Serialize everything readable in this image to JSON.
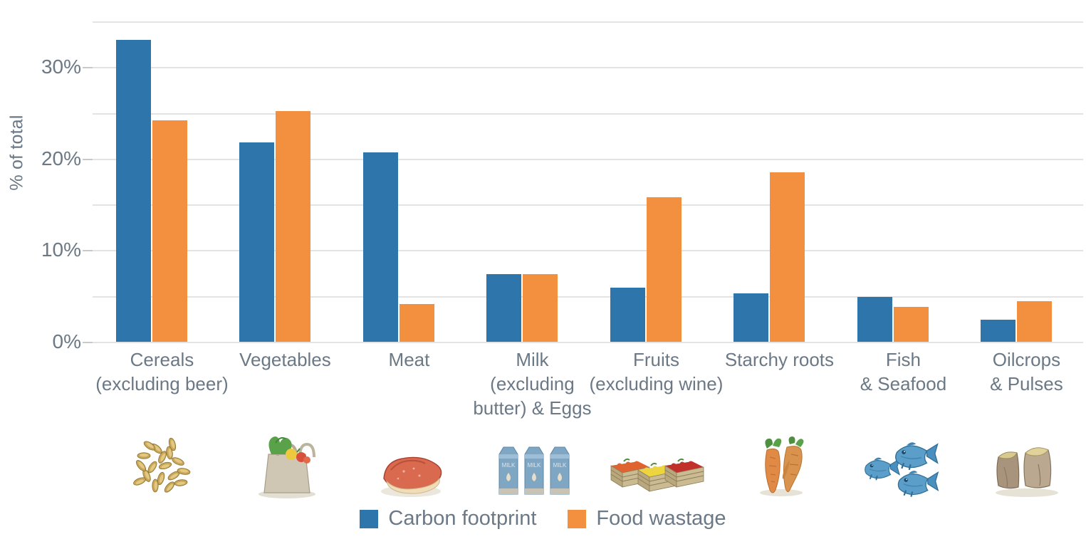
{
  "chart_data": {
    "type": "bar",
    "title": "",
    "xlabel": "",
    "ylabel": "% of total",
    "ylim": [
      0,
      35
    ],
    "ytick_step": 5,
    "ytick_labels": [
      "0%",
      "10%",
      "20%",
      "30%"
    ],
    "ytick_label_values": [
      0,
      10,
      20,
      30
    ],
    "grid": true,
    "legend_position": "bottom-center",
    "categories": [
      "Cereals\n(excluding beer)",
      "Vegetables",
      "Meat",
      "Milk\n(excluding\nbutter) & Eggs",
      "Fruits\n(excluding wine)",
      "Starchy roots",
      "Fish\n& Seafood",
      "Oilcrops\n& Pulses"
    ],
    "series": [
      {
        "name": "Carbon footprint",
        "color": "#2e75ab",
        "values": [
          33.0,
          21.8,
          20.7,
          7.4,
          5.9,
          5.3,
          4.9,
          2.4
        ]
      },
      {
        "name": "Food wastage",
        "color": "#f3903f",
        "values": [
          24.2,
          25.2,
          4.1,
          7.4,
          15.8,
          18.5,
          3.8,
          4.4
        ]
      }
    ]
  },
  "axis": {
    "y_title": "% of total",
    "ticks": [
      {
        "value": 35,
        "label": ""
      },
      {
        "value": 30,
        "label": "30%"
      },
      {
        "value": 25,
        "label": ""
      },
      {
        "value": 20,
        "label": "20%"
      },
      {
        "value": 15,
        "label": ""
      },
      {
        "value": 10,
        "label": "10%"
      },
      {
        "value": 5,
        "label": ""
      },
      {
        "value": 0,
        "label": "0%"
      }
    ]
  },
  "categories": [
    {
      "lines": [
        "Cereals",
        "(excluding beer)"
      ],
      "icon": "grain-seeds-icon"
    },
    {
      "lines": [
        "Vegetables"
      ],
      "icon": "shopping-bag-vegetables-icon"
    },
    {
      "lines": [
        "Meat"
      ],
      "icon": "steak-icon"
    },
    {
      "lines": [
        "Milk",
        "(excluding",
        "butter) & Eggs"
      ],
      "icon": "milk-cartons-icon"
    },
    {
      "lines": [
        "Fruits",
        "(excluding wine)"
      ],
      "icon": "fruit-crates-icon"
    },
    {
      "lines": [
        "Starchy roots"
      ],
      "icon": "carrots-icon"
    },
    {
      "lines": [
        "Fish",
        "& Seafood"
      ],
      "icon": "fish-icon"
    },
    {
      "lines": [
        "Oilcrops",
        "& Pulses"
      ],
      "icon": "grain-sacks-icon"
    }
  ],
  "legend": {
    "items": [
      {
        "label": "Carbon footprint",
        "color": "#2e75ab"
      },
      {
        "label": "Food wastage",
        "color": "#f3903f"
      }
    ]
  },
  "colors": {
    "carbon": "#2e75ab",
    "waste": "#f3903f",
    "text": "#6b7886",
    "gridline": "#e3e3e3",
    "background": "#ffffff"
  }
}
